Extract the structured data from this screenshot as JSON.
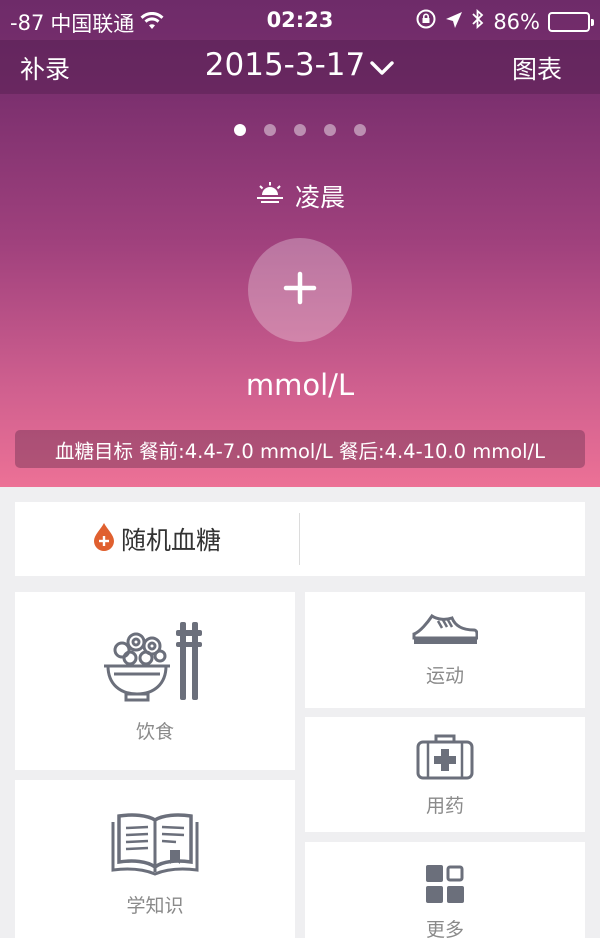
{
  "status_bar": {
    "signal": "-87",
    "carrier": "中国联通",
    "time": "02:23",
    "battery": "86%",
    "battery_level": 0.86
  },
  "nav": {
    "left_label": "补录",
    "date": "2015-3-17",
    "right_label": "图表"
  },
  "pager": {
    "count": 5,
    "active_index": 0
  },
  "period": {
    "label": "凌晨",
    "icon": "sunrise-icon"
  },
  "reading": {
    "add_icon": "plus-icon",
    "unit": "mmol/L"
  },
  "target": {
    "text": "血糖目标 餐前:4.4-7.0 mmol/L 餐后:4.4-10.0 mmol/L"
  },
  "random_glucose": {
    "label": "随机血糖",
    "icon": "blood-drop-plus-icon"
  },
  "tiles": {
    "diet": {
      "label": "饮食",
      "icon": "noodle-bowl-chopsticks-icon"
    },
    "sport": {
      "label": "运动",
      "icon": "sneaker-icon"
    },
    "medicine": {
      "label": "用药",
      "icon": "medical-kit-icon"
    },
    "learn": {
      "label": "学知识",
      "icon": "open-book-icon"
    },
    "more": {
      "label": "更多",
      "icon": "grid-icon"
    }
  },
  "colors": {
    "hero_top": "#6e2b69",
    "hero_bottom": "#ec7196",
    "drop": "#e0602f",
    "icon_gray": "#6b6f7b"
  }
}
